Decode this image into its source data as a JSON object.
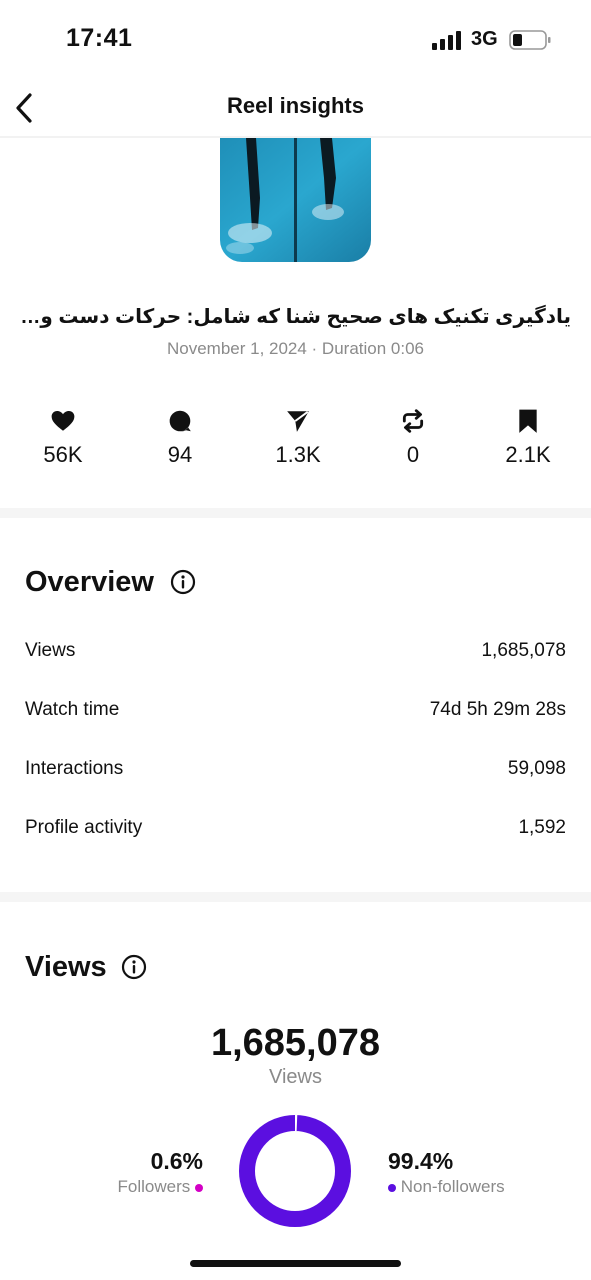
{
  "status_bar": {
    "time": "17:41",
    "network": "3G"
  },
  "header": {
    "title": "Reel insights"
  },
  "reel": {
    "caption": "یادگیری تکنیک های صحیح شنا که شامل: حرکات دست و پا...",
    "meta": "November 1, 2024 · Duration 0:06"
  },
  "stats": [
    {
      "icon": "heart-icon",
      "value": "56K"
    },
    {
      "icon": "comment-icon",
      "value": "94"
    },
    {
      "icon": "share-icon",
      "value": "1.3K"
    },
    {
      "icon": "repost-icon",
      "value": "0"
    },
    {
      "icon": "bookmark-icon",
      "value": "2.1K"
    }
  ],
  "overview": {
    "title": "Overview",
    "rows": [
      {
        "label": "Views",
        "value": "1,685,078"
      },
      {
        "label": "Watch time",
        "value": "74d 5h 29m 28s"
      },
      {
        "label": "Interactions",
        "value": "59,098"
      },
      {
        "label": "Profile activity",
        "value": "1,592"
      }
    ]
  },
  "views": {
    "title": "Views",
    "total": "1,685,078",
    "total_label": "Views",
    "followers_pct": "0.6%",
    "followers_label": "Followers",
    "non_followers_pct": "99.4%",
    "non_followers_label": "Non-followers",
    "followers_fraction": 0.006,
    "followers_color": "#d300c5",
    "non_followers_color": "#5b0fe0"
  }
}
